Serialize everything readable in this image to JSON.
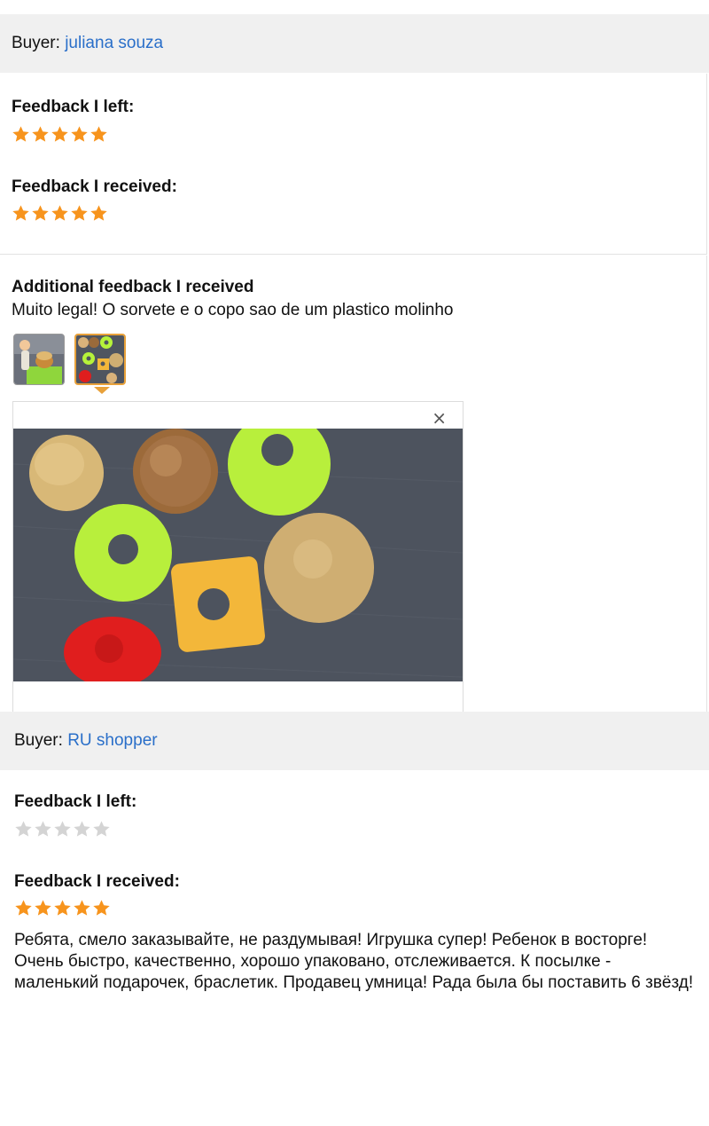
{
  "reviews": [
    {
      "buyer_prefix": "Buyer:",
      "buyer_name": "juliana souza",
      "left_label": "Feedback I left:",
      "left_rating": 5,
      "received_label": "Feedback I received:",
      "received_rating": 5,
      "additional": {
        "heading": "Additional feedback I received",
        "text": "Muito legal! O sorvete e o copo sao de um plastico molinho"
      },
      "thumbnails": [
        "photo-thumbnail-1",
        "photo-thumbnail-2"
      ],
      "active_thumbnail": 2,
      "close_icon": "×"
    },
    {
      "buyer_prefix": "Buyer:",
      "buyer_name": "RU shopper",
      "left_label": "Feedback I left:",
      "left_rating": 0,
      "received_label": "Feedback I received:",
      "received_rating": 5,
      "text": "Ребята, смело заказывайте, не раздумывая! Игрушка супер! Ребенок в восторге! Очень быстро, качественно, хорошо упаковано, отслеживается. К посылке - маленький подарочек, браслетик. Продавец умница! Рада была бы поставить 6 звёзд!"
    }
  ],
  "colors": {
    "star_filled": "#f7941d",
    "star_empty": "#d4d4d4",
    "link": "#2a6fc9",
    "bar_bg": "#f0f0f0"
  },
  "icons": [
    "star-icon",
    "close-icon"
  ]
}
